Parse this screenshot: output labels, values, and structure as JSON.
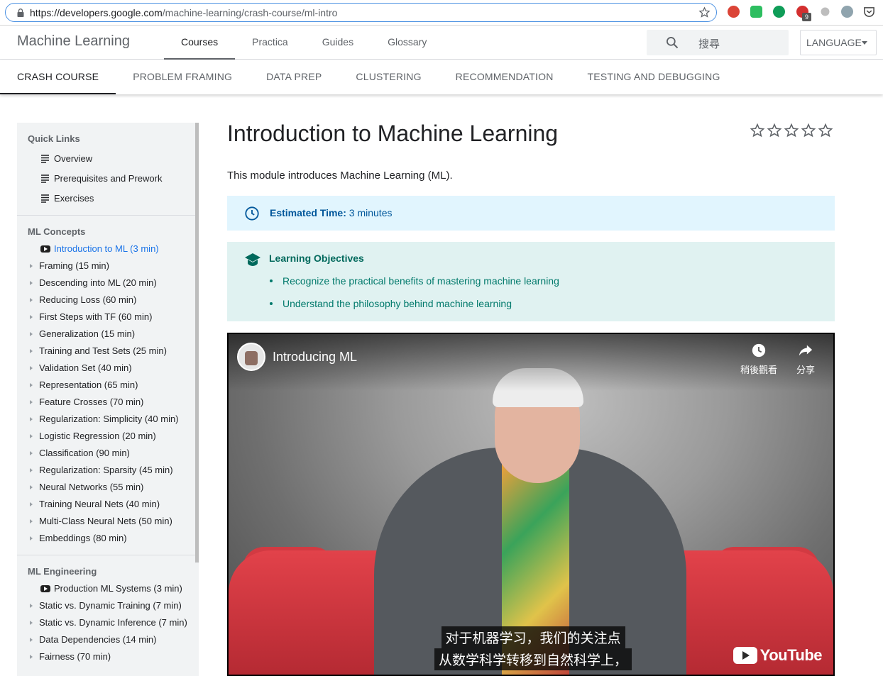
{
  "browser": {
    "url_host": "https://developers.google.com",
    "url_path": "/machine-learning/crash-course/ml-intro",
    "extension_badge": "9"
  },
  "header": {
    "site_title": "Machine Learning",
    "tabs": [
      {
        "label": "Courses"
      },
      {
        "label": "Practica"
      },
      {
        "label": "Guides"
      },
      {
        "label": "Glossary"
      }
    ],
    "search_placeholder": "搜尋",
    "language_label": "LANGUAGE"
  },
  "section_tabs": [
    {
      "label": "CRASH COURSE"
    },
    {
      "label": "PROBLEM FRAMING"
    },
    {
      "label": "DATA PREP"
    },
    {
      "label": "CLUSTERING"
    },
    {
      "label": "RECOMMENDATION"
    },
    {
      "label": "TESTING AND DEBUGGING"
    }
  ],
  "sidebar": {
    "quick_links_title": "Quick Links",
    "quick_links": [
      {
        "label": "Overview"
      },
      {
        "label": "Prerequisites and Prework"
      },
      {
        "label": "Exercises"
      }
    ],
    "concepts_title": "ML Concepts",
    "concepts": [
      {
        "label": "Introduction to ML (3 min)"
      },
      {
        "label": "Framing (15 min)"
      },
      {
        "label": "Descending into ML (20 min)"
      },
      {
        "label": "Reducing Loss (60 min)"
      },
      {
        "label": "First Steps with TF (60 min)"
      },
      {
        "label": "Generalization (15 min)"
      },
      {
        "label": "Training and Test Sets (25 min)"
      },
      {
        "label": "Validation Set (40 min)"
      },
      {
        "label": "Representation (65 min)"
      },
      {
        "label": "Feature Crosses (70 min)"
      },
      {
        "label": "Regularization: Simplicity (40 min)"
      },
      {
        "label": "Logistic Regression (20 min)"
      },
      {
        "label": "Classification (90 min)"
      },
      {
        "label": "Regularization: Sparsity (45 min)"
      },
      {
        "label": "Neural Networks (55 min)"
      },
      {
        "label": "Training Neural Nets (40 min)"
      },
      {
        "label": "Multi-Class Neural Nets (50 min)"
      },
      {
        "label": "Embeddings (80 min)"
      }
    ],
    "engineering_title": "ML Engineering",
    "engineering": [
      {
        "label": "Production ML Systems (3 min)"
      },
      {
        "label": "Static vs. Dynamic Training (7 min)"
      },
      {
        "label": "Static vs. Dynamic Inference (7 min)"
      },
      {
        "label": "Data Dependencies (14 min)"
      },
      {
        "label": "Fairness (70 min)"
      }
    ]
  },
  "main": {
    "title": "Introduction to Machine Learning",
    "rating_stars": 0,
    "rating_max": 5,
    "intro": "This module introduces Machine Learning (ML).",
    "estimated_time_label": "Estimated Time:",
    "estimated_time_value": "3 minutes",
    "objectives_title": "Learning Objectives",
    "objectives": [
      {
        "text": "Recognize the practical benefits of mastering machine learning"
      },
      {
        "text": "Understand the philosophy behind machine learning"
      }
    ]
  },
  "video": {
    "title": "Introducing ML",
    "watch_later": "稍後觀看",
    "share": "分享",
    "caption_line1": "对于机器学习，我们的关注点",
    "caption_line2": "从数学科学转移到自然科学上，",
    "logo_text": "YouTube"
  },
  "colors": {
    "accent_blue": "#1a73e8",
    "info_bg": "#e1f5fe",
    "objectives_bg": "#e0f2f1",
    "objectives_text": "#00796b"
  }
}
